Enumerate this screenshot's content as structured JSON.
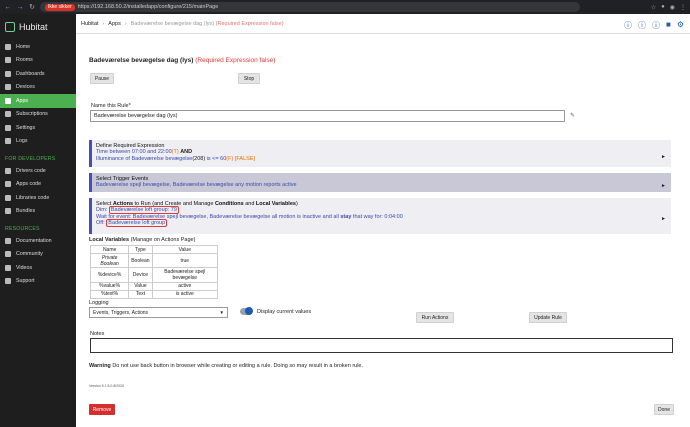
{
  "browser": {
    "warning_label": "Ikke sikker",
    "url": "https://192.168.50.2/installedapp/configure/215/mainPage"
  },
  "sidebar": {
    "brand": "Hubitat",
    "items": [
      {
        "label": "Home",
        "icon": "home-icon"
      },
      {
        "label": "Rooms",
        "icon": "rooms-icon"
      },
      {
        "label": "Dashboards",
        "icon": "dashboards-icon"
      },
      {
        "label": "Devices",
        "icon": "devices-icon"
      },
      {
        "label": "Apps",
        "icon": "apps-icon",
        "active": true
      },
      {
        "label": "Subscriptions",
        "icon": "subscriptions-icon"
      },
      {
        "label": "Settings",
        "icon": "settings-icon"
      },
      {
        "label": "Logs",
        "icon": "logs-icon"
      }
    ],
    "dev_title": "FOR DEVELOPERS",
    "dev_items": [
      {
        "label": "Drivers code",
        "icon": "drivers-code-icon"
      },
      {
        "label": "Apps code",
        "icon": "apps-code-icon"
      },
      {
        "label": "Libraries code",
        "icon": "libraries-code-icon"
      },
      {
        "label": "Bundles",
        "icon": "bundles-icon"
      }
    ],
    "res_title": "RESOURCES",
    "res_items": [
      {
        "label": "Documentation",
        "icon": "documentation-icon"
      },
      {
        "label": "Community",
        "icon": "community-icon"
      },
      {
        "label": "Videos",
        "icon": "videos-icon"
      },
      {
        "label": "Support",
        "icon": "support-icon"
      }
    ]
  },
  "breadcrumb": {
    "home": "Hubitat",
    "apps": "Apps",
    "current": "Badeværelse bevægelse dag (lys)",
    "current_err": "(Required Expression false)"
  },
  "rule": {
    "title": "Badeværelse bevægelse dag (lys)",
    "title_status": "(Required Expression false)",
    "pause_label": "Pause",
    "stop_label": "Stop",
    "name_label": "Name this Rule*",
    "name_value": "Badeværelse bevægelse dag (lys)"
  },
  "panels": {
    "required": {
      "head": "Define Required Expression",
      "line1": "Time between 07:00 and 22:00",
      "line1_flag": "(T)",
      "line1_and": "AND",
      "line2": "Illuminance of Badeværelse bevægelse",
      "line2_value": "(208)",
      "line2_rest": " is <= 60",
      "line2_flag": "(F) [FALSE]"
    },
    "triggers": {
      "head": "Select Trigger Events",
      "line1": "Badeværelse spejl bevægelse, Badeværelse bevægelse any motion reports active"
    },
    "actions": {
      "head_pre": "Select ",
      "head_actions": "Actions",
      "head_mid": " to Run (and Create and Manage ",
      "head_conditions": "Conditions",
      "head_and": " and ",
      "head_local": "Local Variables",
      "head_end": ")",
      "dim_label": "Dim:",
      "dim_target": "Badeværelse loft group: 79",
      "wait_pre": "Wait for event: Badeværelse spejl bevægelse, Badeværelse bevægelse all motion is inactive and all ",
      "wait_stay": "stay",
      "wait_post": " that way for: 0:04:00",
      "off_label": "Off:",
      "off_target": "Badeværelse loft group"
    }
  },
  "local_vars": {
    "title": "Local Variables",
    "subtitle": "(Manage on Actions Page)",
    "columns": [
      "Name",
      "Type",
      "Value"
    ],
    "rows": [
      [
        "Private Boolean",
        "Boolean",
        "true"
      ],
      [
        "%device%",
        "Device",
        "Badeværelse spejl bevægelse"
      ],
      [
        "%value%",
        "Value",
        "active"
      ],
      [
        "%text%",
        "Text",
        "is active"
      ]
    ]
  },
  "logging": {
    "label": "Logging",
    "value": "Events, Triggers, Actions",
    "toggle_label": "Display current values",
    "toggle_on": true,
    "run_actions_label": "Run Actions",
    "update_rule_label": "Update Rule"
  },
  "notes": {
    "label": "Notes",
    "value": ""
  },
  "warning": {
    "bold": "Warning",
    "text": " Do not use back button in browser while creating or editing a rule. Doing so may result in a broken rule."
  },
  "version": "Version 5.1 8.0.8/2020",
  "footer": {
    "remove_label": "Remove",
    "done_label": "Done"
  },
  "colors": {
    "accent": "#4caf50",
    "panel_border": "#3f51b5",
    "error": "#e53935",
    "link": "#3949ab"
  }
}
